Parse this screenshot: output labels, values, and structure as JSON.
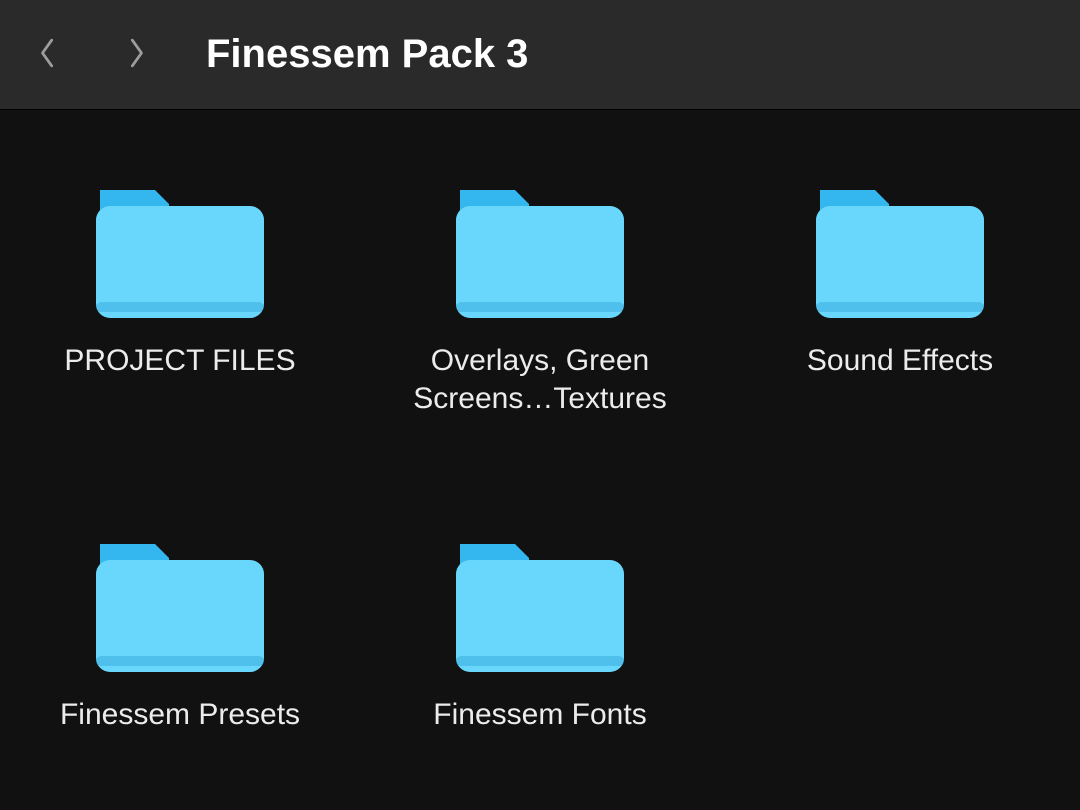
{
  "header": {
    "title": "Finessem Pack 3"
  },
  "folders": {
    "f0": {
      "label": "PROJECT FILES"
    },
    "f1": {
      "label": "Overlays, Green Screens…Textures"
    },
    "f2": {
      "label": "Sound Effects"
    },
    "f3": {
      "label": "Finessem Presets"
    },
    "f4": {
      "label": "Finessem Fonts"
    }
  },
  "colors": {
    "folder_top": "#34b6ef",
    "folder_body": "#68d7fb",
    "folder_shade": "#2ea3d6",
    "toolbar_bg": "#2a2a2a",
    "content_bg": "#111111"
  }
}
